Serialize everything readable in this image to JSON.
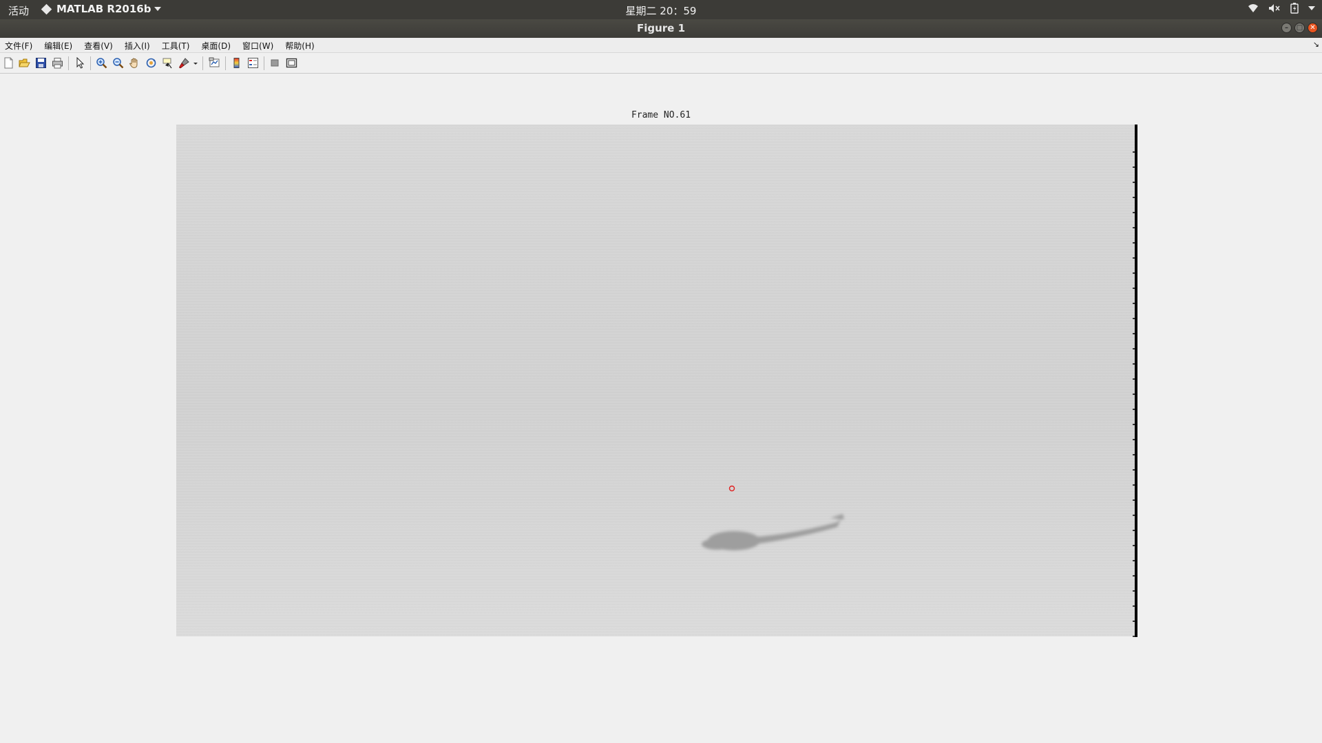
{
  "topbar": {
    "activities": "活动",
    "app_name": "MATLAB R2016b",
    "clock": "星期二 20：59",
    "icons": [
      "wifi-icon",
      "volume-muted-icon",
      "battery-icon",
      "system-menu-caret-icon"
    ]
  },
  "window": {
    "title": "Figure 1",
    "controls": [
      "minimize",
      "maximize",
      "close"
    ]
  },
  "menu": {
    "items": [
      "文件(F)",
      "编辑(E)",
      "查看(V)",
      "插入(I)",
      "工具(T)",
      "桌面(D)",
      "窗口(W)",
      "帮助(H)"
    ]
  },
  "toolbar": {
    "buttons": [
      "new-figure",
      "open-file",
      "save-figure",
      "print-figure",
      "edit-plot",
      "zoom-in",
      "zoom-out",
      "pan",
      "rotate-3d",
      "data-cursor",
      "brush",
      "brush-dropdown",
      "link-plot",
      "insert-colorbar",
      "insert-legend",
      "hide-plot-tools",
      "show-plot-tools"
    ]
  },
  "figure": {
    "axes_title": "Frame NO.61",
    "marker_color": "#e02020",
    "axis_color": "#000000"
  }
}
